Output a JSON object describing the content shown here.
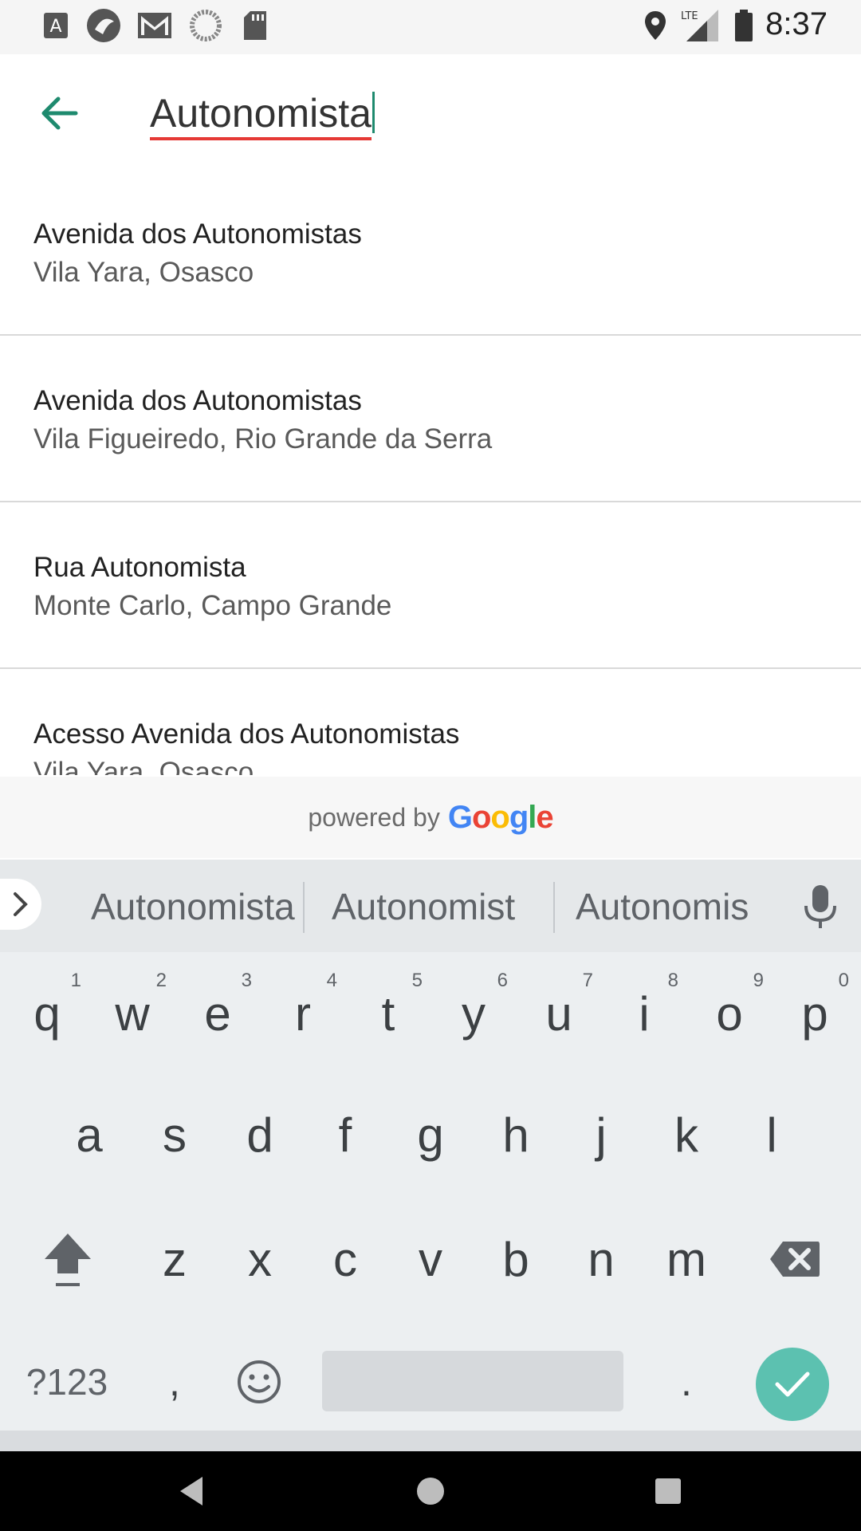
{
  "status_bar": {
    "time": "8:37",
    "left_icons": [
      "text-a-icon",
      "app-circle-icon",
      "gmail-icon",
      "sync-icon",
      "sd-card-icon"
    ],
    "right_icons": [
      "location-icon",
      "lte-signal-icon",
      "battery-icon"
    ],
    "network_label": "LTE"
  },
  "search": {
    "value": "Autonomista"
  },
  "results": [
    {
      "title": "Avenida dos Autonomistas",
      "subtitle": "Vila Yara, Osasco"
    },
    {
      "title": "Avenida dos Autonomistas",
      "subtitle": "Vila Figueiredo, Rio Grande da Serra"
    },
    {
      "title": "Rua Autonomista",
      "subtitle": "Monte Carlo, Campo Grande"
    },
    {
      "title": "Acesso Avenida dos Autonomistas",
      "subtitle": "Vila Yara, Osasco"
    }
  ],
  "powered_by": {
    "prefix": "powered by",
    "brand_letters": [
      "G",
      "o",
      "o",
      "g",
      "l",
      "e"
    ],
    "brand_colors": [
      "#4285F4",
      "#EA4335",
      "#FBBC05",
      "#4285F4",
      "#34A853",
      "#EA4335"
    ]
  },
  "keyboard": {
    "suggestions": [
      "Autonomista",
      "Autonomist",
      "Autonomis"
    ],
    "row1": [
      "q",
      "w",
      "e",
      "r",
      "t",
      "y",
      "u",
      "i",
      "o",
      "p"
    ],
    "row1_hints": [
      "1",
      "2",
      "3",
      "4",
      "5",
      "6",
      "7",
      "8",
      "9",
      "0"
    ],
    "row2": [
      "a",
      "s",
      "d",
      "f",
      "g",
      "h",
      "j",
      "k",
      "l"
    ],
    "row3": [
      "z",
      "x",
      "c",
      "v",
      "b",
      "n",
      "m"
    ],
    "symbols_key": "?123",
    "comma_key": ",",
    "period_key": ".",
    "accent_color": "#5cc1b0"
  },
  "colors": {
    "back_arrow": "#1e8a6e",
    "spell_underline": "#e53935"
  }
}
